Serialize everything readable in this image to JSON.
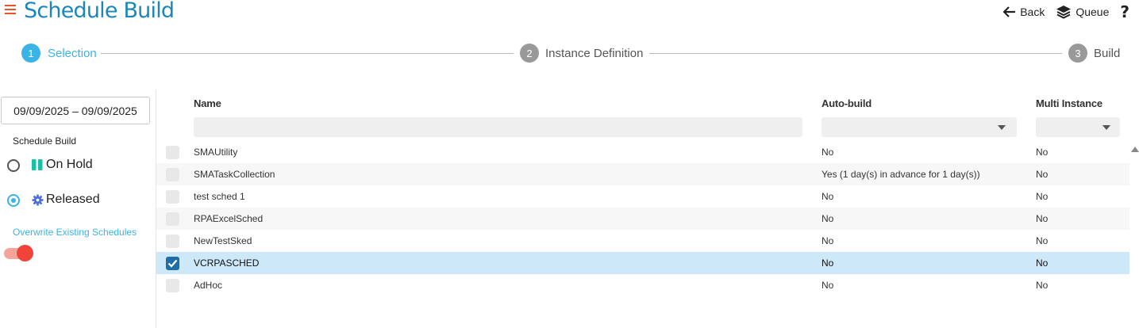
{
  "header": {
    "title": "Schedule Build",
    "back_label": "Back",
    "queue_label": "Queue",
    "help_label": "?"
  },
  "stepper": {
    "steps": [
      {
        "number": "1",
        "label": "Selection",
        "active": true
      },
      {
        "number": "2",
        "label": "Instance Definition",
        "active": false
      },
      {
        "number": "3",
        "label": "Build",
        "active": false
      }
    ]
  },
  "sidebar": {
    "date_range": "09/09/2025 – 09/09/2025",
    "section_label": "Schedule Build",
    "options": [
      {
        "label": "On Hold",
        "icon": "pause-icon",
        "selected": false
      },
      {
        "label": "Released",
        "icon": "gear-icon",
        "selected": true
      }
    ],
    "overwrite_label": "Overwrite Existing Schedules",
    "overwrite_enabled": true
  },
  "table": {
    "columns": {
      "name": "Name",
      "auto_build": "Auto-build",
      "multi_instance": "Multi Instance"
    },
    "rows": [
      {
        "name": "SMAUtility",
        "auto_build": "No",
        "multi_instance": "No",
        "checked": false
      },
      {
        "name": "SMATaskCollection",
        "auto_build": "Yes (1 day(s) in advance for 1 day(s))",
        "multi_instance": "No",
        "checked": false
      },
      {
        "name": "test sched 1",
        "auto_build": "No",
        "multi_instance": "No",
        "checked": false
      },
      {
        "name": "RPAExcelSched",
        "auto_build": "No",
        "multi_instance": "No",
        "checked": false
      },
      {
        "name": "NewTestSked",
        "auto_build": "No",
        "multi_instance": "No",
        "checked": false
      },
      {
        "name": "VCRPASCHED",
        "auto_build": "No",
        "multi_instance": "No",
        "checked": true
      },
      {
        "name": "AdHoc",
        "auto_build": "No",
        "multi_instance": "No",
        "checked": false
      }
    ]
  },
  "colors": {
    "accent": "#3ab3e6",
    "title": "#1a87b8",
    "menu": "#e8572a",
    "toggle_on": "#f0443b",
    "selected_row": "#cde8f9",
    "checkbox_checked": "#1e6fa8",
    "pause_icon": "#1bbfa6",
    "gear_icon": "#4a6fd8"
  }
}
